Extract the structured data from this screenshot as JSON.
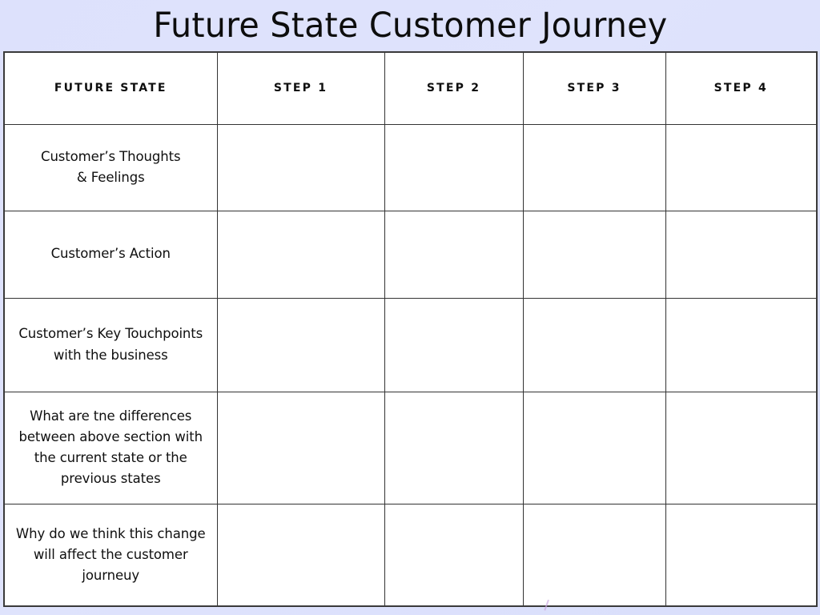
{
  "slide": {
    "title": "Future State Customer Journey",
    "background_color": "#dde1fc"
  },
  "colors": {
    "header_label_bg": "#bdeef0",
    "header_step_bg": "#f9c6c6",
    "cell_bg": "#ffffff",
    "border": "#333333",
    "text": "#0f0f0f"
  },
  "table": {
    "columns": [
      {
        "key": "label",
        "label": "FUTURE STATE",
        "type": "label"
      },
      {
        "key": "step1",
        "label": "STEP 1",
        "type": "step"
      },
      {
        "key": "step2",
        "label": "STEP 2",
        "type": "step"
      },
      {
        "key": "step3",
        "label": "STEP 3",
        "type": "step"
      },
      {
        "key": "step4",
        "label": "STEP 4",
        "type": "step"
      }
    ],
    "rows": [
      {
        "label_line1": "Customer’s Thoughts",
        "label_line2": "& Feelings",
        "label_line3": "",
        "label_line4": "",
        "step1": "",
        "step2": "",
        "step3": "",
        "step4": ""
      },
      {
        "label_line1": "Customer’s Action",
        "label_line2": "",
        "label_line3": "",
        "label_line4": "",
        "step1": "",
        "step2": "",
        "step3": "",
        "step4": ""
      },
      {
        "label_line1": "Customer’s Key Touchpoints",
        "label_line2": "with the business",
        "label_line3": "",
        "label_line4": "",
        "step1": "",
        "step2": "",
        "step3": "",
        "step4": ""
      },
      {
        "label_line1": "What are tne differences",
        "label_line2": "between above section with",
        "label_line3": "the current state or the",
        "label_line4": "previous states",
        "step1": "",
        "step2": "",
        "step3": "",
        "step4": ""
      },
      {
        "label_line1": "Why do we think this change",
        "label_line2": "will affect the customer",
        "label_line3": "journeuy",
        "label_line4": "",
        "step1": "",
        "step2": "",
        "step3": "",
        "step4": ""
      }
    ]
  }
}
